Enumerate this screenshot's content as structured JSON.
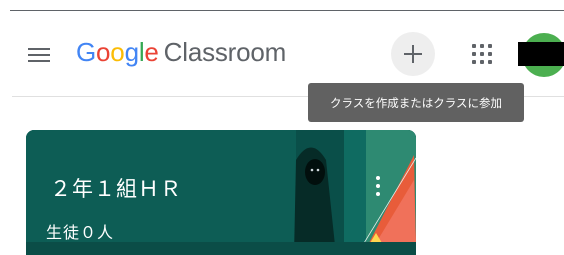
{
  "header": {
    "logo": {
      "g1": "G",
      "o1": "o",
      "o2": "o",
      "g2": "g",
      "l": "l",
      "e": "e",
      "product": "Classroom"
    },
    "menu_icon": "hamburger-menu-icon",
    "add_icon": "plus-icon",
    "apps_icon": "apps-grid-icon"
  },
  "tooltip": {
    "text": "クラスを作成またはクラスに参加"
  },
  "class_card": {
    "title": "２年１組ＨＲ",
    "subtitle": "生徒０人",
    "more_icon": "more-vert-icon",
    "theme_color": "#0d5d55"
  },
  "colors": {
    "google_blue": "#4285f4",
    "google_red": "#ea4335",
    "google_yellow": "#fbbc05",
    "google_green": "#34a853",
    "avatar": "#4caf50",
    "tooltip_bg": "#616161"
  }
}
